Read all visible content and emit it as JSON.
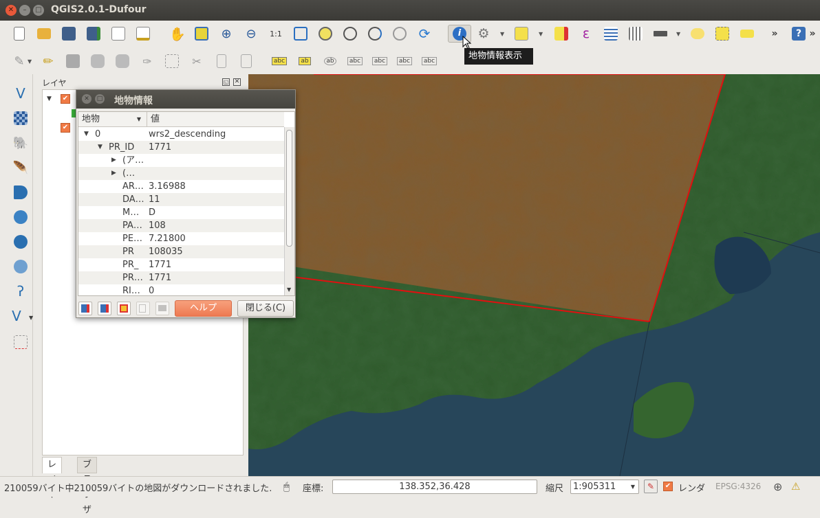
{
  "window": {
    "title": "QGIS2.0.1-Dufour"
  },
  "tooltip": {
    "text": "地物情報表示"
  },
  "layer_panel": {
    "title": "レイヤ",
    "tabs": [
      "レイヤ",
      "ブラウザ"
    ]
  },
  "dialog": {
    "title": "地物情報",
    "columns": [
      "地物",
      "値"
    ],
    "rows": [
      {
        "key": "0",
        "value": "wrs2_descending"
      },
      {
        "key": "PR_ID",
        "value": "1771"
      },
      {
        "key": "(ア…",
        "value": ""
      },
      {
        "key": "(…",
        "value": ""
      },
      {
        "key": "AR…",
        "value": "3.16988"
      },
      {
        "key": "DA…",
        "value": "11"
      },
      {
        "key": "M…",
        "value": "D"
      },
      {
        "key": "PA…",
        "value": "108"
      },
      {
        "key": "PE…",
        "value": "7.21800"
      },
      {
        "key": "PR",
        "value": "108035"
      },
      {
        "key": "PR_",
        "value": "1771"
      },
      {
        "key": "PR…",
        "value": "1771"
      },
      {
        "key": "RI…",
        "value": "0"
      }
    ],
    "help_label": "ヘルプ",
    "close_label": "閉じる(C)"
  },
  "statusbar": {
    "message": "210059バイト中210059バイトの地図がダウンロードされました.",
    "coord_label": "座標:",
    "coord_value": "138.352,36.428",
    "scale_label": "縮尺",
    "scale_value": "1:905311",
    "render_label": "レンダ",
    "crs": "EPSG:4326"
  },
  "colors": {
    "accent": "#f0825e",
    "selection_border": "#e01010",
    "map_water": "#27465a"
  }
}
